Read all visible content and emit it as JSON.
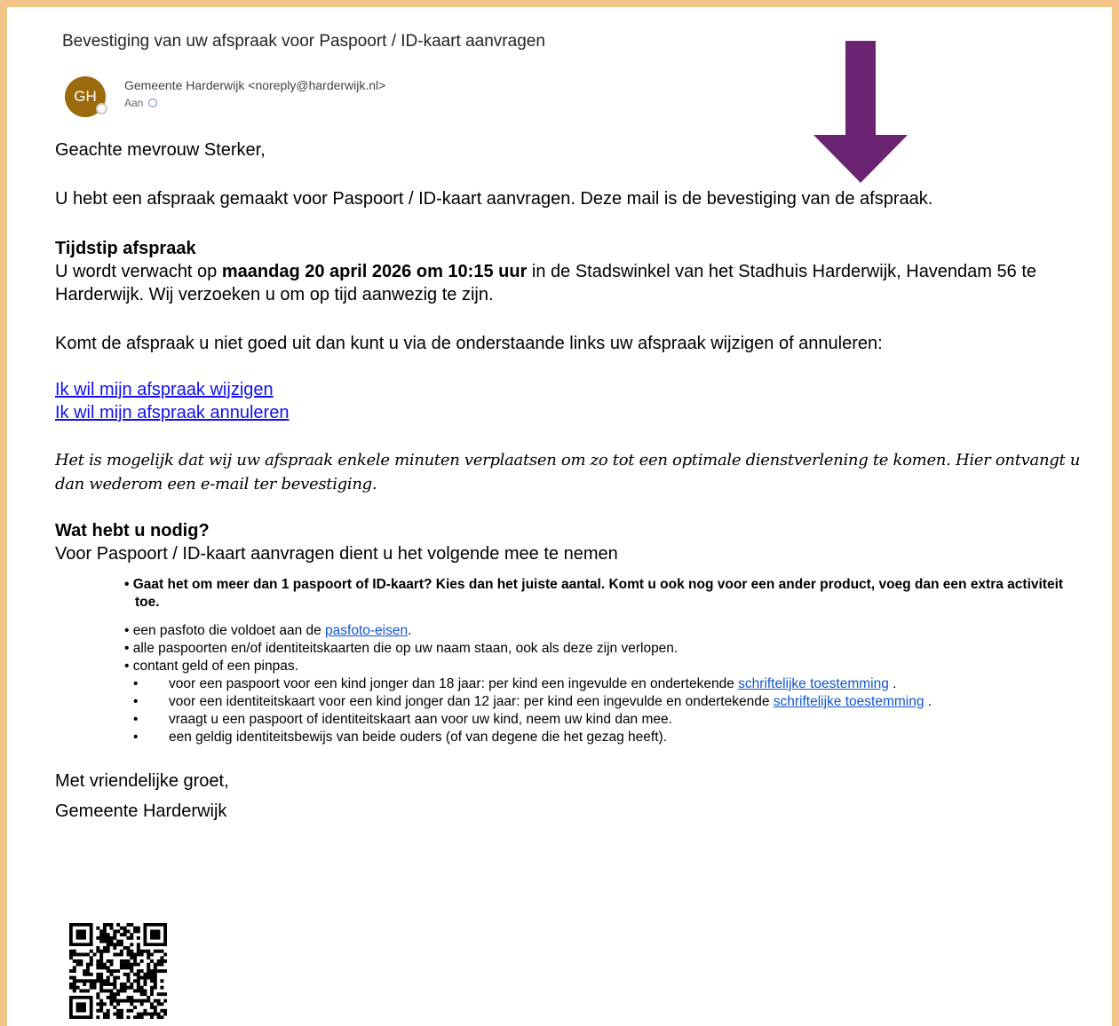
{
  "email": {
    "subject": "Bevestiging van uw afspraak voor Paspoort / ID-kaart aanvragen",
    "avatar_initials": "GH",
    "sender": "Gemeente Harderwijk <noreply@harderwijk.nl>",
    "to_label": "Aan"
  },
  "body": {
    "greeting": "Geachte mevrouw Sterker,",
    "intro": "U hebt een afspraak gemaakt voor Paspoort / ID-kaart aanvragen. Deze mail is de bevestiging van de afspraak.",
    "time_heading": "Tijdstip afspraak",
    "time_prefix": "U wordt verwacht op ",
    "time_bold": "maandag 20 april 2026 om 10:15 uur",
    "time_suffix": " in de Stadswinkel van het Stadhuis Harderwijk, Havendam 56 te Harderwijk. Wij verzoeken u om op tijd aanwezig te zijn.",
    "change_text": "Komt de afspraak u niet goed uit dan kunt u via de onderstaande links uw afspraak wijzigen of annuleren:",
    "link_change": "Ik wil mijn afspraak wijzigen",
    "link_cancel": "Ik wil mijn afspraak annuleren",
    "note": "Het is mogelijk dat wij uw afspraak enkele minuten verplaatsen om zo tot een optimale dienstverlening te komen. Hier ontvangt u dan wederom een e-mail ter bevestiging.",
    "need_heading": "Wat hebt u nodig?",
    "need_intro": "Voor Paspoort / ID-kaart aanvragen dient u het volgende mee te nemen",
    "bullet_bold": "Gaat het om meer dan 1 paspoort of ID-kaart? Kies dan het juiste aantal. Komt u ook nog voor een ander product, voeg dan een extra activiteit toe.",
    "bullet_photo_prefix": "een pasfoto die voldoet aan de ",
    "bullet_photo_link": "pasfoto-eisen",
    "bullet_photo_suffix": ".",
    "bullet_documents": "alle paspoorten en/of identiteitskaarten die op uw naam staan, ook als deze zijn verlopen.",
    "bullet_money": "contant geld of een pinpas.",
    "sub1_prefix": "voor een paspoort voor een kind jonger dan 18 jaar: per kind een ingevulde en ondertekende ",
    "sub1_link": "schriftelijke toestemming",
    "sub1_suffix": " .",
    "sub2_prefix": "voor een identiteitskaart voor een kind jonger dan 12 jaar: per kind een ingevulde en ondertekende ",
    "sub2_link": "schriftelijke toestemming",
    "sub2_suffix": " .",
    "sub3": "vraagt u een paspoort of identiteitskaart aan voor uw kind, neem uw kind dan mee.",
    "sub4": "een geldig identiteitsbewijs van beide ouders (of van degene die het gezag heeft).",
    "closing": "Met vriendelijke groet,",
    "signature": "Gemeente Harderwijk"
  },
  "colors": {
    "frame": "#f3c489",
    "avatar": "#9a6a0c",
    "arrow": "#6b2471",
    "link": "#1010ee"
  },
  "icons": {
    "arrow": "down-arrow-icon",
    "qr": "qr-code-icon"
  }
}
